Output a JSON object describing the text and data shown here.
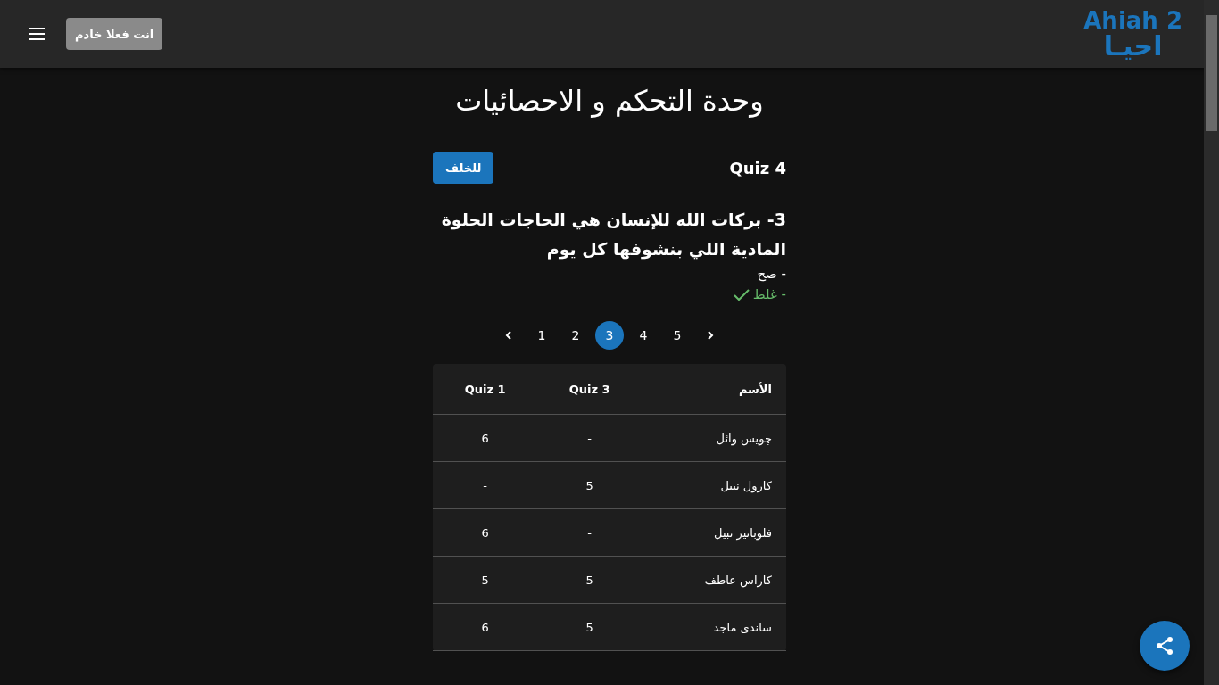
{
  "header": {
    "disabled_button": {
      "label": "انت فعلا خادم",
      "disabled": true
    },
    "logo": {
      "latin": "Ahiah 2",
      "arabic": "احيـا"
    }
  },
  "title": "وحدة التحكم و الاحصائيات",
  "quiz": {
    "name": "Quiz 4",
    "back_button": "للخلف"
  },
  "question": {
    "text": "3- بركات الله للإنسان هي الحاجات الحلوة المادية اللي بنشوفها كل يوم",
    "answers": [
      {
        "text": "- صح",
        "correct": false
      },
      {
        "text": "- غلط",
        "correct": true
      }
    ]
  },
  "pagination": {
    "pages": [
      {
        "label": "5",
        "selected": false
      },
      {
        "label": "4",
        "selected": false
      },
      {
        "label": "3",
        "selected": true
      },
      {
        "label": "2",
        "selected": false
      },
      {
        "label": "1",
        "selected": false
      }
    ]
  },
  "table": {
    "columns": [
      "الأسم",
      "Quiz 3",
      "Quiz 1"
    ],
    "rows": [
      [
        "چويس وائل",
        "-",
        "6"
      ],
      [
        "كارول نبيل",
        "5",
        "-"
      ],
      [
        "فلوباتير نبيل",
        "-",
        "6"
      ],
      [
        "كاراس عاطف",
        "5",
        "5"
      ],
      [
        "ساندى ماجد",
        "5",
        "6"
      ]
    ]
  }
}
